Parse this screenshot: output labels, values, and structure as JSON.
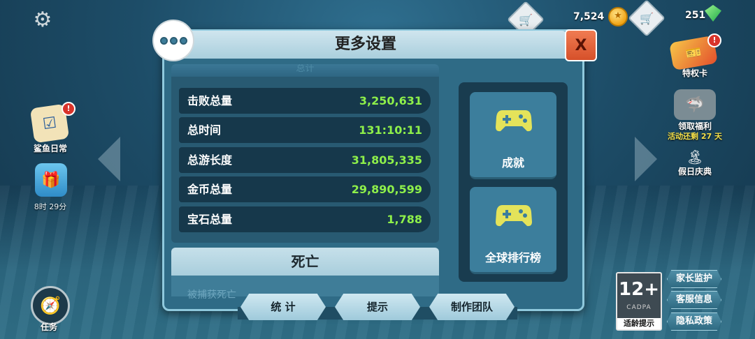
{
  "topbar": {
    "coins": "7,524",
    "gems": "251"
  },
  "left_widgets": {
    "shark_daily": "鲨鱼日常",
    "gift_timer": "8时 29分",
    "tasks": "任务"
  },
  "right_widgets": {
    "privilege_card": "特权卡",
    "welfare": "领取福利",
    "event_remaining": "活动还剩 27 天",
    "holiday": "假日庆典"
  },
  "dialog": {
    "title": "更多设置",
    "close_label": "X",
    "faded_top_text": "总计",
    "stats": [
      {
        "label": "击败总量",
        "value": "3,250,631"
      },
      {
        "label": "总时间",
        "value": "131:10:11"
      },
      {
        "label": "总游长度",
        "value": "31,805,335"
      },
      {
        "label": "金币总量",
        "value": "29,890,599"
      },
      {
        "label": "宝石总量",
        "value": "1,788"
      }
    ],
    "death_header": "死亡",
    "death_sub_text": "被捕获死亡",
    "achievements_label": "成就",
    "leaderboard_label": "全球排行榜",
    "tabs": [
      "统 计",
      "提示",
      "制作团队"
    ]
  },
  "age_rating": {
    "number": "12+",
    "org": "CADPA",
    "label": "适龄提示"
  },
  "info_buttons": [
    "家长监护",
    "客服信息",
    "隐私政策"
  ],
  "colors": {
    "stat_value": "#8ef04a",
    "close_button": "#d6502a",
    "gamepad": "#e4e35a"
  }
}
